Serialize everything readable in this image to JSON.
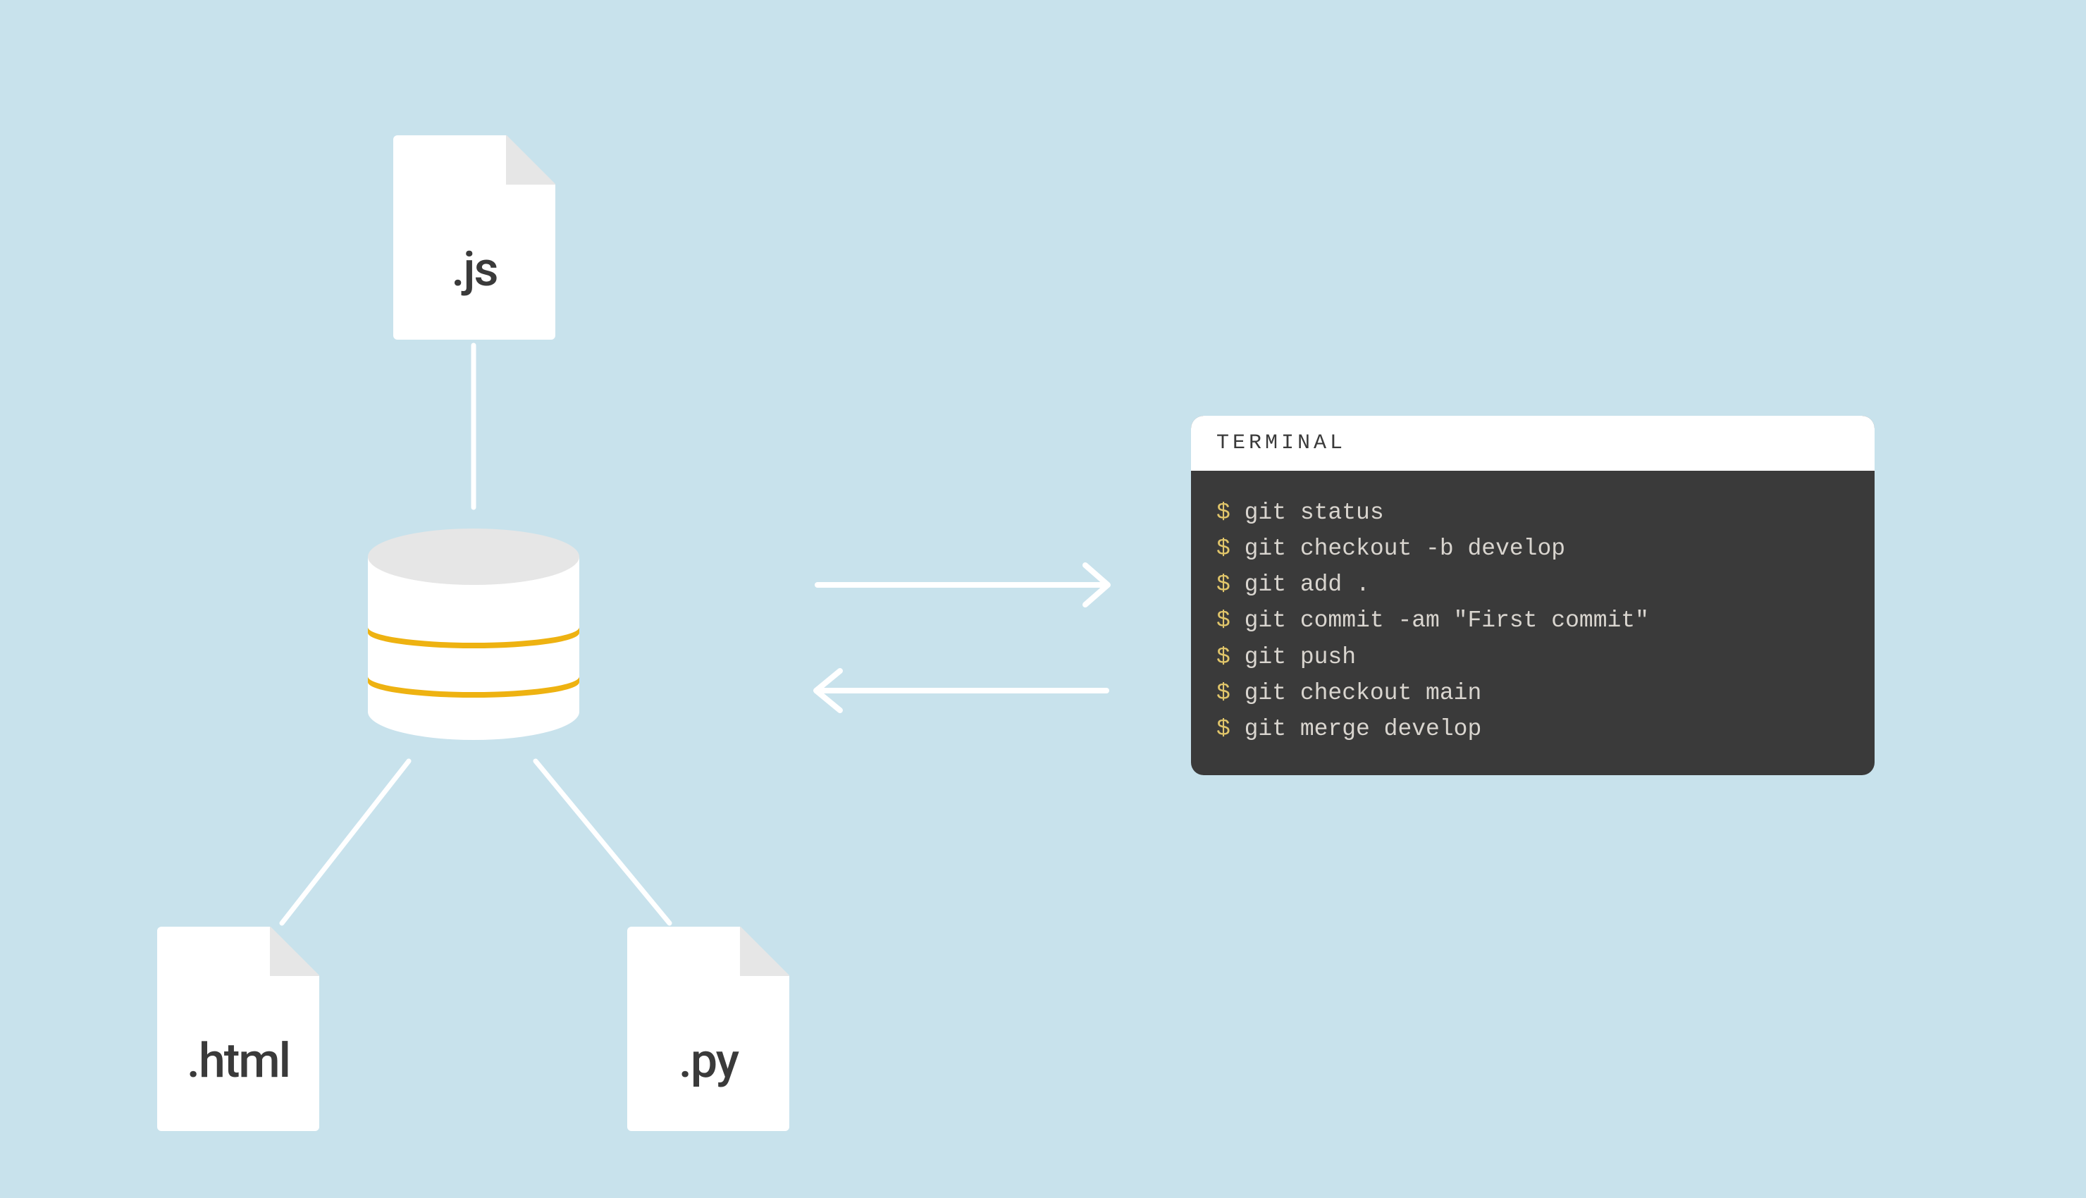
{
  "files": {
    "top": {
      "ext": ".js"
    },
    "left": {
      "ext": ".html"
    },
    "right": {
      "ext": ".py"
    }
  },
  "terminal": {
    "title": "TERMINAL",
    "prompt": "$",
    "lines": [
      "git status",
      "git checkout -b develop",
      "git add .",
      "git commit -am \"First commit\"",
      "git push",
      "git checkout main",
      "git merge develop"
    ]
  }
}
